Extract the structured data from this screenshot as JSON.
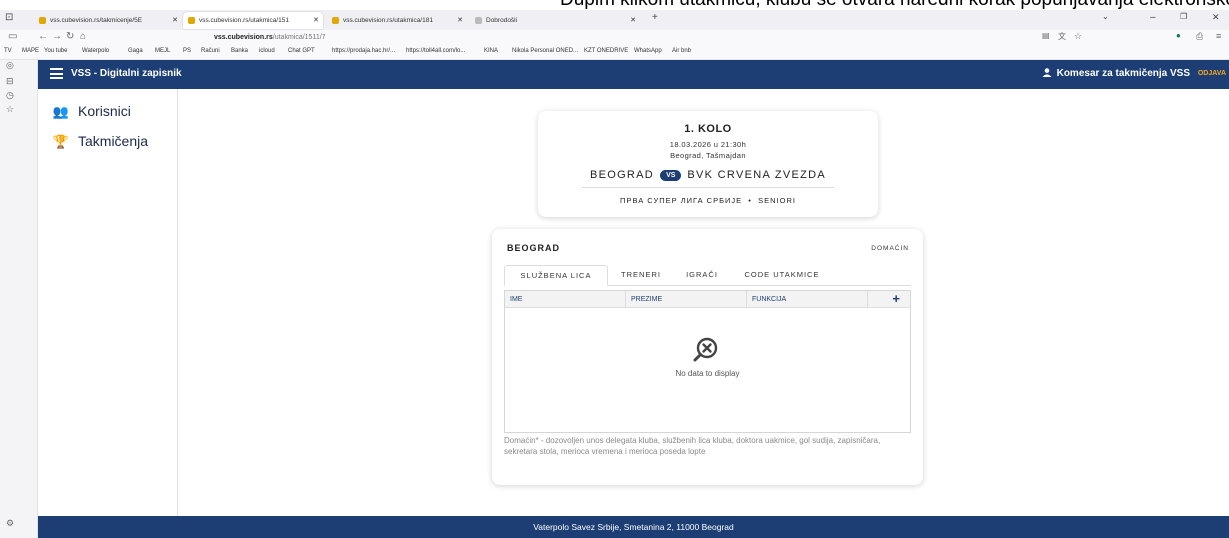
{
  "doc_caption": "Dupim klikom utakmicu, klubu se otvara naredni korak popunjavanja elektronskog zapisnika:",
  "browser": {
    "tabs": [
      {
        "label": "vss.cubevision.rs/takmicenje/5E",
        "active": false
      },
      {
        "label": "vss.cubevision.rs/utakmica/151",
        "active": true
      },
      {
        "label": "vss.cubevision.rs/utakmica/181",
        "active": false
      },
      {
        "label": "Dobrodošli",
        "active": false
      }
    ],
    "url_domain": "vss.cubevision.rs",
    "url_path": "/utakmica/1511/7",
    "bookmarks": [
      "TV",
      "MAPE",
      "You tube",
      "Waterpolo",
      "Gaga",
      "MEJL",
      "PS",
      "Računi",
      "Banka",
      "icloud",
      "Chat GPT",
      "https://prodaja.hac.hr/...",
      "https://toll4all.com/lo...",
      "KINA",
      "Nikola Personal ONED...",
      "KZT ONEDRIVE",
      "WhatsApp",
      "Air bnb"
    ]
  },
  "app": {
    "title": "VSS - Digitalni zapisnik",
    "user": "Komesar za takmičenja VSS",
    "logout": "ODJAVA"
  },
  "sidebar": {
    "items": [
      {
        "label": "Korisnici",
        "icon": "users-icon"
      },
      {
        "label": "Takmičenja",
        "icon": "trophy-icon"
      }
    ]
  },
  "match": {
    "round": "1. KOLO",
    "datetime": "18.03.2026 u 21:30h",
    "venue": "Beograd, Tašmajdan",
    "home": "BEOGRAD",
    "vs": "VS",
    "away": "BVK CRVENA ZVEZDA",
    "league": "ПРВА СУПЕР ЛИГА СРБИЈЕ",
    "category": "SENIORI"
  },
  "panel": {
    "team": "BEOGRAD",
    "role": "DOMAĆIN",
    "tabs": [
      "SLUŽBENA LICA",
      "TRENERI",
      "IGRAČI",
      "CODE UTAKMICE"
    ],
    "columns": [
      "IME",
      "PREZIME",
      "FUNKCIJA"
    ],
    "add": "+",
    "empty": "No data to display",
    "note": "Domaćin* - dozovoljen unos delegata kluba, službenih lica kluba, doktora uakmice, gol sudija, zapisničara, sekretara stola, merioca vremena i merioca poseda lopte"
  },
  "footer": "Vaterpolo Savez Srbije, Smetanina 2, 11000 Beograd",
  "colors": {
    "primary": "#1c3e74",
    "accent": "#f5a623"
  }
}
